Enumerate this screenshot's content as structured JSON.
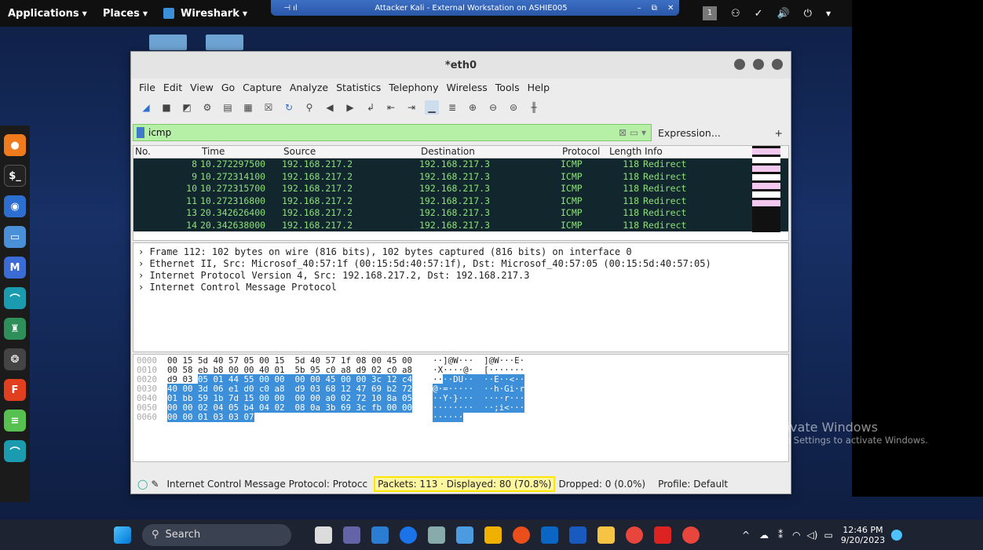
{
  "top_panel": {
    "applications": "Applications",
    "places": "Places",
    "wireshark": "Wireshark",
    "workspace": "1"
  },
  "rdp_bar": {
    "title": "Attacker Kali - External Workstation on ASHIE005"
  },
  "window": {
    "title": "*eth0",
    "menu": [
      "File",
      "Edit",
      "View",
      "Go",
      "Capture",
      "Analyze",
      "Statistics",
      "Telephony",
      "Wireless",
      "Tools",
      "Help"
    ]
  },
  "filter": {
    "value": "icmp",
    "expression_label": "Expression...",
    "plus": "+"
  },
  "packet_list": {
    "headers": [
      "No.",
      "Time",
      "Source",
      "Destination",
      "Protocol",
      "Length",
      "Info"
    ],
    "rows": [
      [
        "8",
        "10.272297500",
        "192.168.217.2",
        "192.168.217.3",
        "ICMP",
        "118",
        "Redirect"
      ],
      [
        "9",
        "10.272314100",
        "192.168.217.2",
        "192.168.217.3",
        "ICMP",
        "118",
        "Redirect"
      ],
      [
        "10",
        "10.272315700",
        "192.168.217.2",
        "192.168.217.3",
        "ICMP",
        "118",
        "Redirect"
      ],
      [
        "11",
        "10.272316800",
        "192.168.217.2",
        "192.168.217.3",
        "ICMP",
        "118",
        "Redirect"
      ],
      [
        "13",
        "20.342626400",
        "192.168.217.2",
        "192.168.217.3",
        "ICMP",
        "118",
        "Redirect"
      ],
      [
        "14",
        "20.342638000",
        "192.168.217.2",
        "192.168.217.3",
        "ICMP",
        "118",
        "Redirect"
      ]
    ]
  },
  "details": [
    "Frame 112: 102 bytes on wire (816 bits), 102 bytes captured (816 bits) on interface 0",
    "Ethernet II, Src: Microsof_40:57:1f (00:15:5d:40:57:1f), Dst: Microsof_40:57:05 (00:15:5d:40:57:05)",
    "Internet Protocol Version 4, Src: 192.168.217.2, Dst: 192.168.217.3",
    "Internet Control Message Protocol"
  ],
  "hex": [
    {
      "off": "0000",
      "plain": "00 15 5d 40 57 05 00 15  5d 40 57 1f 08 00 45 00",
      "hl": "",
      "ascii_plain": "··]@W···  ]@W···E·",
      "ascii_hl": ""
    },
    {
      "off": "0010",
      "plain": "00 58 eb b8 00 00 40 01  5b 95 c0 a8 d9 02 c0 a8",
      "hl": "",
      "ascii_plain": "·X····@·  [·······",
      "ascii_hl": ""
    },
    {
      "off": "0020",
      "plain": "d9 03 ",
      "hl": "05 01 44 55 00 00  00 00 45 00 00 3c 12 c4",
      "ascii_plain": "··",
      "ascii_hl": "··DU··  ··E··<··"
    },
    {
      "off": "0030",
      "plain": "",
      "hl": "40 00 3d 06 e1 d0 c0 a8  d9 03 68 12 47 69 b2 72",
      "ascii_plain": "",
      "ascii_hl": "@·=·····  ··h·Gi·r"
    },
    {
      "off": "0040",
      "plain": "",
      "hl": "01 bb 59 1b 7d 15 00 00  00 00 a0 02 72 10 8a 05",
      "ascii_plain": "",
      "ascii_hl": "··Y·}···  ····r···"
    },
    {
      "off": "0050",
      "plain": "",
      "hl": "00 00 02 04 05 b4 04 02  08 0a 3b 69 3c fb 00 00",
      "ascii_plain": "",
      "ascii_hl": "········  ··;i<···"
    },
    {
      "off": "0060",
      "plain": "",
      "hl": "00 00 01 03 03 07",
      "ascii_plain": "",
      "ascii_hl": "······"
    }
  ],
  "status": {
    "text": "Internet Control Message Protocol: Protocc",
    "packets": "Packets: 113 · Displayed: 80 (70.8%)",
    "dropped": "Dropped: 0 (0.0%)",
    "profile": "Profile: Default"
  },
  "activate": {
    "line1": "Activate Windows",
    "line2": "Go to Settings to activate Windows."
  },
  "taskbar": {
    "search": "Search",
    "time": "12:46 PM",
    "date": "9/20/2023"
  }
}
